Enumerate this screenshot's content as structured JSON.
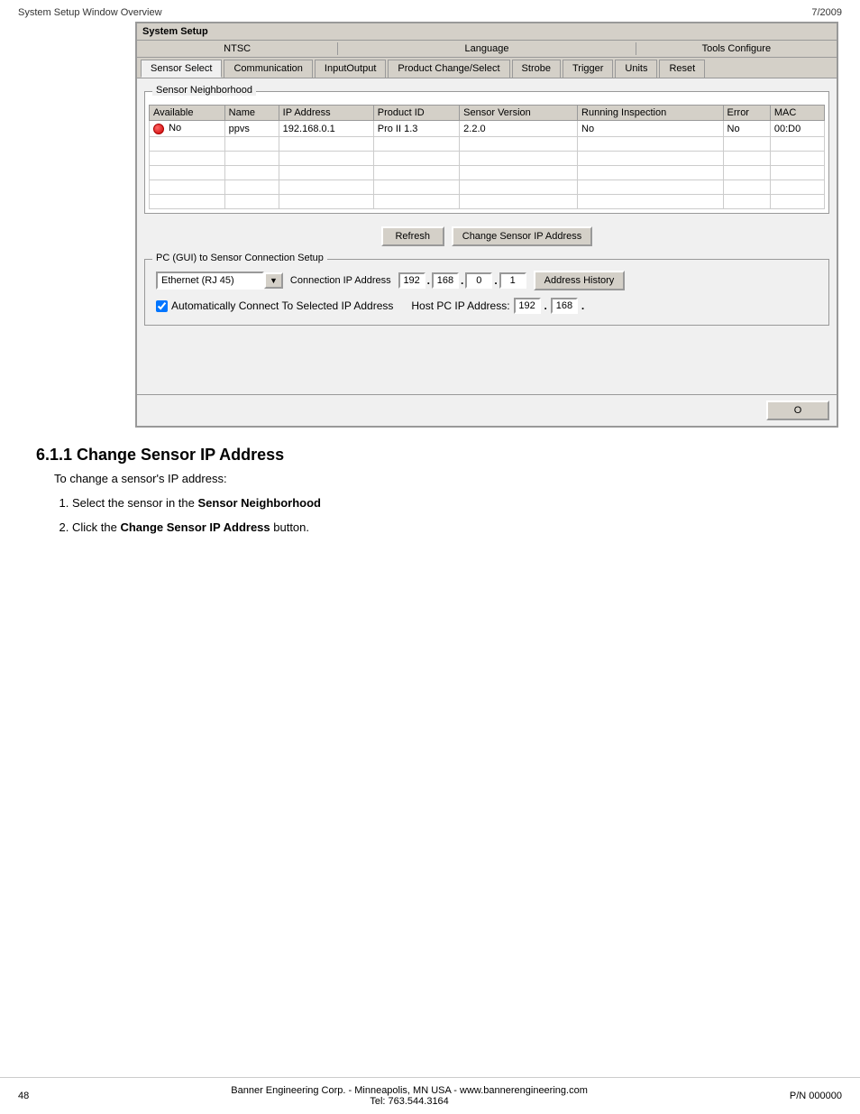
{
  "page": {
    "header_left": "System Setup Window Overview",
    "header_right": "7/2009",
    "footer_left": "48",
    "footer_center_line1": "Banner Engineering Corp. - Minneapolis, MN USA - www.bannerengineering.com",
    "footer_center_line2": "Tel: 763.544.3164",
    "footer_right": "P/N 000000"
  },
  "window": {
    "title": "System Setup",
    "tabs_top_row": {
      "group1": "NTSC",
      "group2": "Language",
      "group3": "Tools Configure"
    },
    "tabs_main": [
      "Sensor Select",
      "Communication",
      "InputOutput",
      "Product Change/Select",
      "Strobe",
      "Trigger",
      "Units",
      "Reset"
    ]
  },
  "sensor_neighborhood": {
    "title": "Sensor Neighborhood",
    "columns": [
      "Available",
      "Name",
      "IP Address",
      "Product ID",
      "Sensor Version",
      "Running Inspection",
      "Error",
      "MAC"
    ],
    "rows": [
      {
        "available_status": "red",
        "available_text": "No",
        "name": "ppvs",
        "ip_address": "192.168.0.1",
        "product_id": "Pro II 1.3",
        "sensor_version": "2.2.0",
        "running_inspection": "No",
        "error": "No",
        "mac": "00:D0"
      }
    ],
    "empty_rows": 5,
    "refresh_button": "Refresh",
    "change_ip_button": "Change Sensor IP Address"
  },
  "connection_setup": {
    "title": "PC (GUI) to Sensor Connection Setup",
    "connection_type": "Ethernet (RJ 45)",
    "connection_ip_label": "Connection IP Address",
    "ip_parts": [
      "192",
      "168",
      "0",
      "1"
    ],
    "address_history_button": "Address History",
    "auto_connect_label": "Automatically Connect To Selected IP Address",
    "auto_connect_checked": true,
    "host_pc_label": "Host PC IP Address:",
    "host_pc_ip": [
      "192",
      "168"
    ]
  },
  "section": {
    "heading": "6.1.1 Change Sensor IP Address",
    "intro": "To change a sensor's IP address:",
    "steps": [
      {
        "text_plain": "Select the sensor in the ",
        "text_bold": "Sensor Neighborhood",
        "text_after": ""
      },
      {
        "text_plain": "Click the ",
        "text_bold": "Change Sensor IP Address",
        "text_after": " button."
      }
    ]
  }
}
